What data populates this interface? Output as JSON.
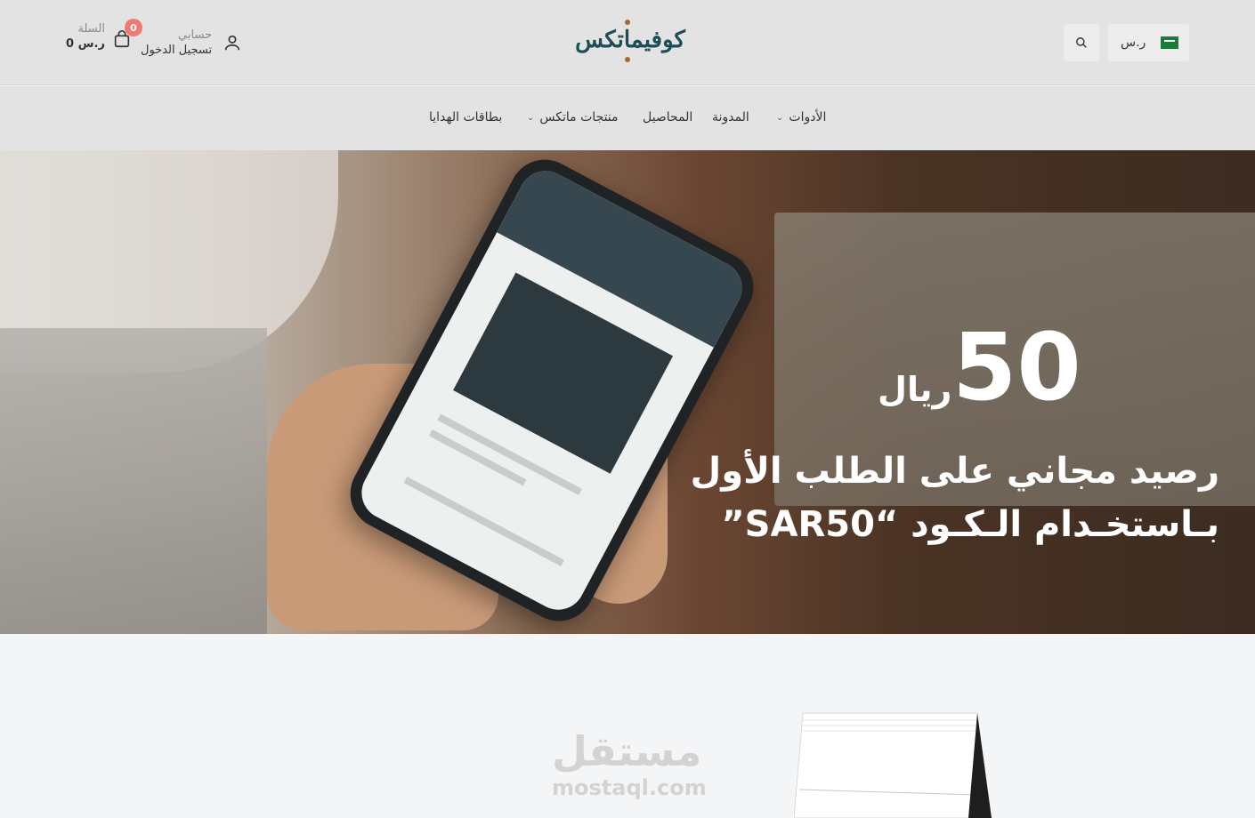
{
  "header": {
    "account_label": "حسابي",
    "login_label": "تسجيل الدخول",
    "cart_label": "السلة",
    "cart_total": "0 ر.س",
    "cart_count": "0",
    "logo_text": "كوفيماتكس",
    "currency": "ر.س",
    "flag_icon": "saudi-flag-icon",
    "search_icon": "search-icon"
  },
  "nav": {
    "tools": "الأدوات",
    "blog": "المدونة",
    "crops": "المحاصيل",
    "matex_products": "منتجات ماتكس",
    "gift_cards": "بطاقات الهدايا"
  },
  "hero": {
    "amount": "50",
    "currency_word": "ريال",
    "line1": "رصيد مجاني على الطلب الأول",
    "line2": "بـاستخـدام الـكـود “SAR50”"
  },
  "watermark": {
    "arabic": "مستقل",
    "latin": "mostaql.com"
  },
  "colors": {
    "brand": "#1d4e57",
    "accent": "#a6682f",
    "badge": "#f07a72"
  }
}
